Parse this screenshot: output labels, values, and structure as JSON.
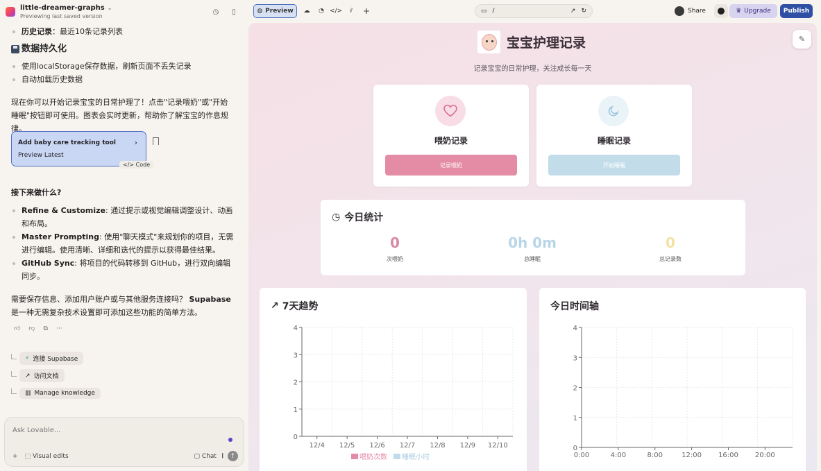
{
  "project": {
    "name": "little-dreamer-graphs",
    "status": "Previewing last saved version"
  },
  "chat": {
    "history_title": "历史记录",
    "history_text": "：最近10条记录列表",
    "persist_heading": "数据持久化",
    "persist_items": [
      "使用localStorage保存数据，刷新页面不丢失记录",
      "自动加载历史数据"
    ],
    "summary": "现在你可以开始记录宝宝的日常护理了！点击\"记录喂奶\"或\"开始睡眠\"按钮即可使用。图表会实时更新，帮助你了解宝宝的作息规律。",
    "card_title": "Add baby care tracking tool",
    "card_subtitle": "Preview Latest",
    "code_label": "Code",
    "next_heading": "接下来做什么?",
    "next_items": [
      {
        "title": "Refine & Customize",
        "text": ": 通过提示或视觉编辑调整设计、动画和布局。"
      },
      {
        "title": "Master Prompting",
        "text": ": 使用\"聊天模式\"来规划你的项目，无需进行编辑。使用清晰、详细和迭代的提示以获得最佳结果。"
      },
      {
        "title": "GitHub Sync",
        "text": ": 将项目的代码转移到 GitHub，进行双向编辑同步。"
      }
    ],
    "supabase_text_1": "需要保存信息、添加用户账户或与其他服务连接吗？",
    "supabase_bold": "Supabase",
    "supabase_text_2": " 是一种无需复杂技术设置即可添加这些功能的简单方法。",
    "links": [
      "连接 Supabase",
      "访问文档",
      "Manage knowledge"
    ]
  },
  "composer": {
    "placeholder": "Ask Lovable...",
    "visual_edits": "Visual edits",
    "chat": "Chat"
  },
  "topbar": {
    "preview": "Preview",
    "url": "/",
    "share": "Share",
    "upgrade": "Upgrade",
    "publish": "Publish"
  },
  "app": {
    "title": "宝宝护理记录",
    "subtitle": "记录宝宝的日常护理，关注成长每一天",
    "feeding_label": "喂奶记录",
    "feeding_button": "记录喂奶",
    "sleep_label": "睡眠记录",
    "sleep_button": "开始睡眠",
    "stats_title": "今日统计",
    "stats": [
      {
        "value": "0",
        "label": "次喂奶",
        "color": "#d98aa2"
      },
      {
        "value": "0h 0m",
        "label": "总睡眠",
        "color": "#b9d6e6"
      },
      {
        "value": "0",
        "label": "总记录数",
        "color": "#f4e2a4"
      }
    ]
  },
  "colors": {
    "feeding": "#e48ba6",
    "sleep": "#c3dcea",
    "publish": "#2f4fa5"
  },
  "chart_data": [
    {
      "type": "bar",
      "title": "7天趋势",
      "categories": [
        "12/4",
        "12/5",
        "12/6",
        "12/7",
        "12/8",
        "12/9",
        "12/10"
      ],
      "series": [
        {
          "name": "喂奶次数",
          "values": [
            0,
            0,
            0,
            0,
            0,
            0,
            0
          ]
        },
        {
          "name": "睡眠小时",
          "values": [
            0,
            0,
            0,
            0,
            0,
            0,
            0
          ]
        }
      ],
      "ylim": [
        0,
        4
      ],
      "yticks": [
        0,
        1,
        2,
        3,
        4
      ],
      "grid": true,
      "legend": "bottom"
    },
    {
      "type": "scatter",
      "title": "今日时间轴",
      "x": [],
      "y": [],
      "xticks": [
        "0:00",
        "4:00",
        "8:00",
        "12:00",
        "16:00",
        "20:00"
      ],
      "ylim": [
        0,
        4
      ],
      "yticks": [
        0,
        1,
        2,
        3,
        4
      ],
      "grid": true
    }
  ]
}
